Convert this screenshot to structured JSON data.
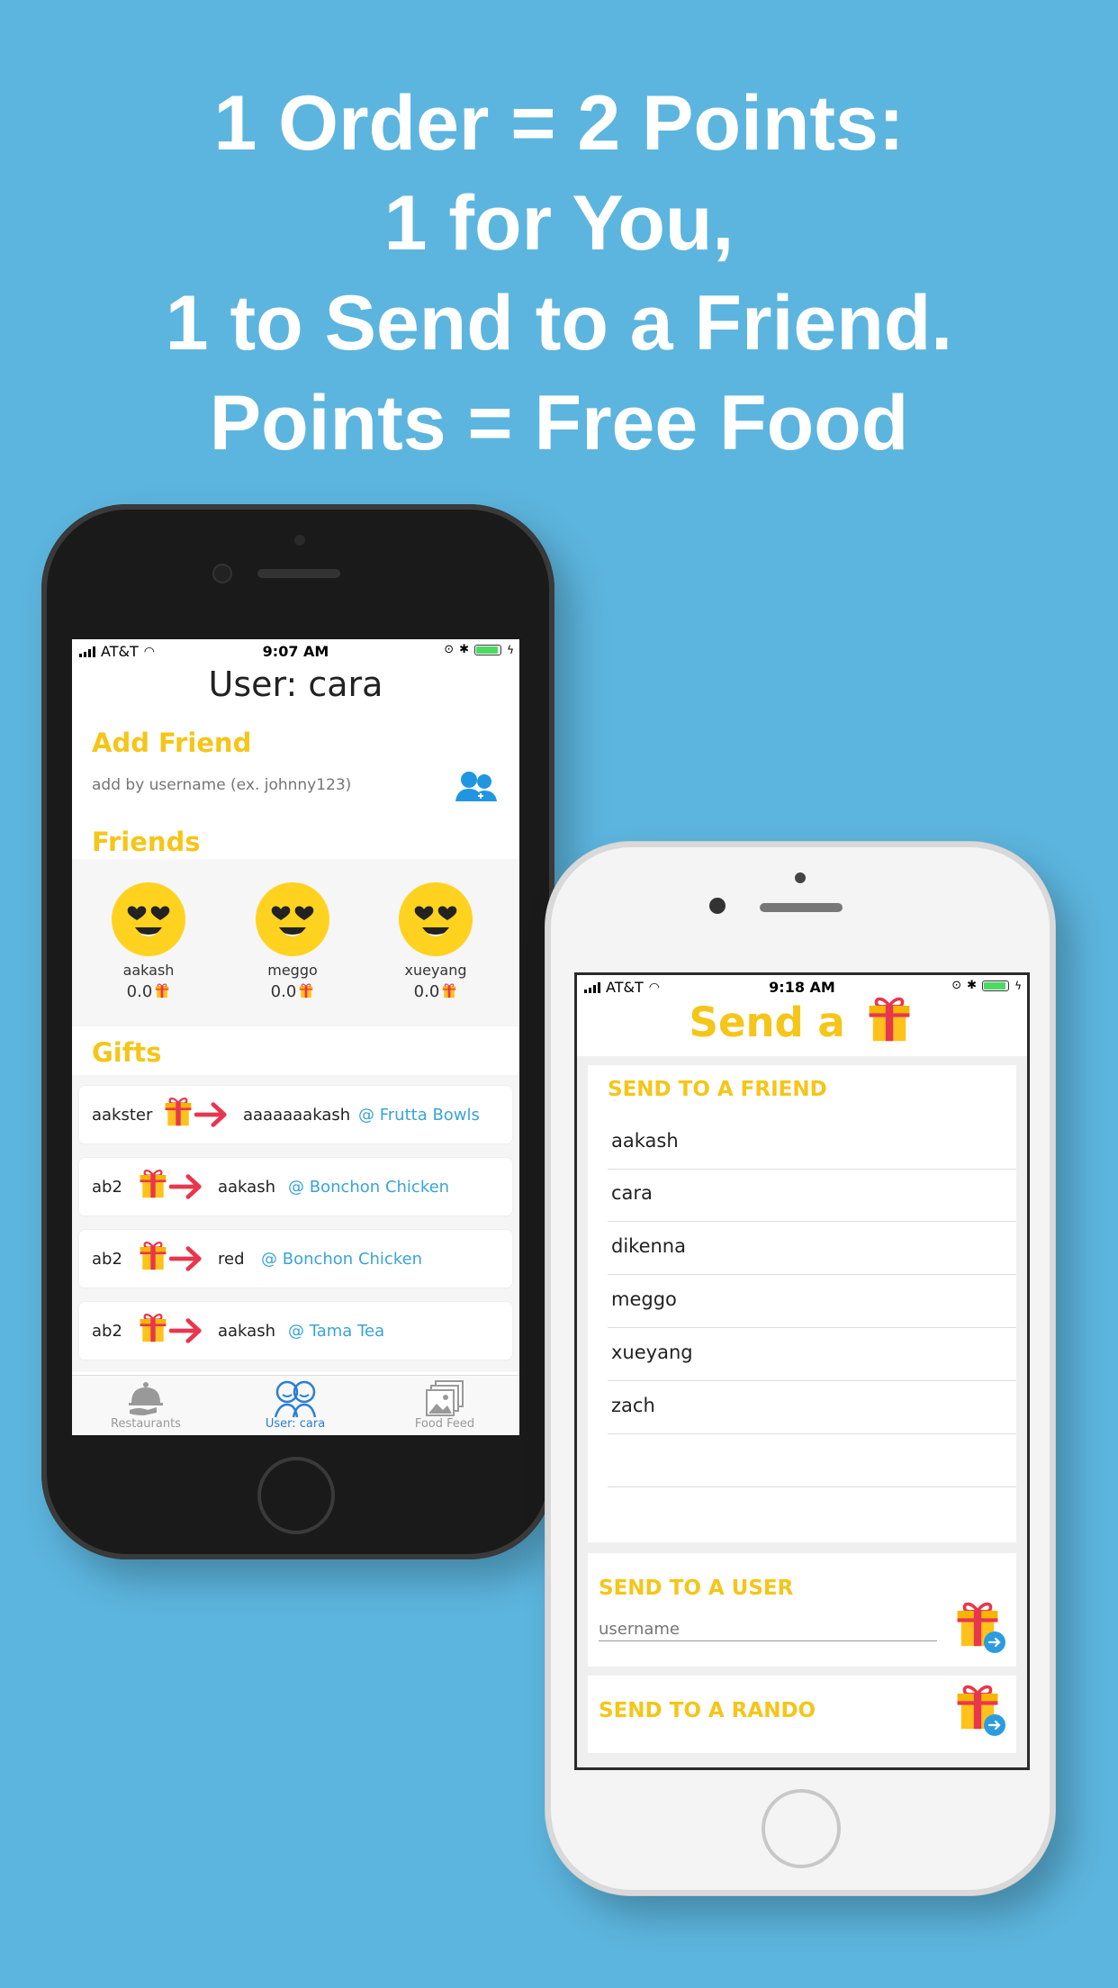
{
  "headline": [
    "1 Order = 2 Points:",
    "1 for You,",
    "1 to Send to a Friend.",
    "Points = Free Food"
  ],
  "colors": {
    "background": "#5cb5de",
    "accent": "#f5c518",
    "link": "#3aa3d8",
    "arrow": "#e8364e"
  },
  "phone1": {
    "status": {
      "carrier": "AT&T",
      "time": "9:07 AM"
    },
    "title": "User: cara",
    "add_friend": {
      "heading": "Add Friend",
      "placeholder": "add by username (ex. johnny123)",
      "icon": "add-friend-icon"
    },
    "friends": {
      "heading": "Friends",
      "items": [
        {
          "name": "aakash",
          "points": "0.0"
        },
        {
          "name": "meggo",
          "points": "0.0"
        },
        {
          "name": "xueyang",
          "points": "0.0"
        }
      ]
    },
    "gifts": {
      "heading": "Gifts",
      "items": [
        {
          "from": "aakster",
          "to": "aaaaaaakash",
          "place": "@ Frutta Bowls"
        },
        {
          "from": "ab2",
          "to": "aakash",
          "place": "@ Bonchon Chicken"
        },
        {
          "from": "ab2",
          "to": "red",
          "place": "@ Bonchon Chicken"
        },
        {
          "from": "ab2",
          "to": "aakash",
          "place": "@ Tama Tea"
        }
      ]
    },
    "tabs": [
      {
        "label": "Restaurants",
        "icon": "cloche-icon"
      },
      {
        "label": "User: cara",
        "icon": "users-icon"
      },
      {
        "label": "Food Feed",
        "icon": "photos-icon"
      }
    ]
  },
  "phone2": {
    "status": {
      "carrier": "AT&T",
      "time": "9:18 AM"
    },
    "title": "Send a",
    "send_friend": {
      "heading": "SEND TO A FRIEND",
      "items": [
        "aakash",
        "cara",
        "dikenna",
        "meggo",
        "xueyang",
        "zach"
      ]
    },
    "send_user": {
      "heading": "SEND TO A USER",
      "placeholder": "username"
    },
    "send_rando": {
      "heading": "SEND TO A RANDO"
    }
  }
}
